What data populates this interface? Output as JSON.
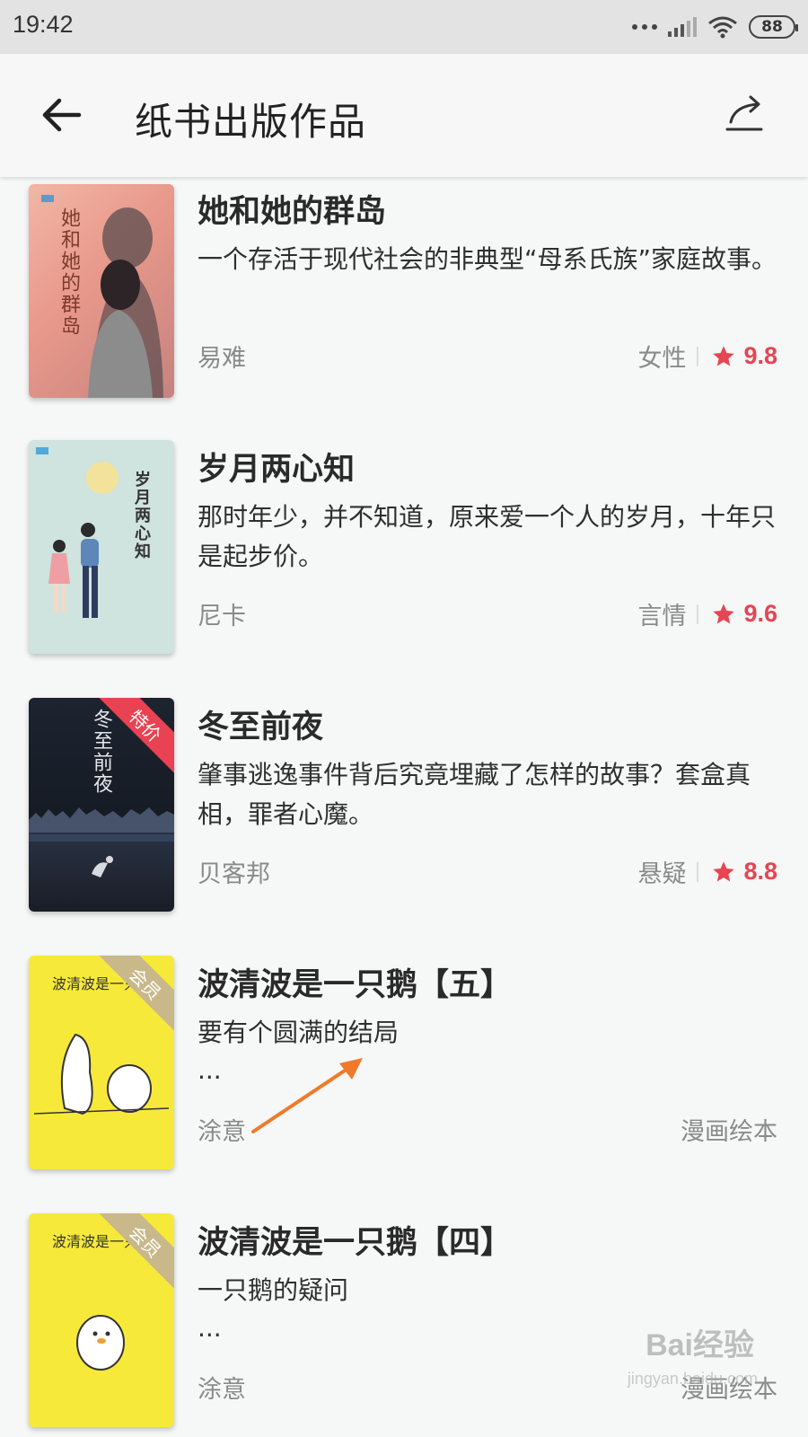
{
  "status_bar": {
    "time": "19:42",
    "battery": "88"
  },
  "header": {
    "title": "纸书出版作品",
    "back_icon": "arrow-left-icon",
    "share_icon": "share-icon"
  },
  "books": [
    {
      "title": "她和她的群岛",
      "desc": "一个存活于现代社会的非典型“母系氏族”家庭故事。",
      "author": "易难",
      "category": "女性",
      "rating": "9.8",
      "cover_text": "她和她的群岛",
      "badge": ""
    },
    {
      "title": "岁月两心知",
      "desc": "那时年少，并不知道，原来爱一个人的岁月，十年只是起步价。",
      "author": "尼卡",
      "category": "言情",
      "rating": "9.6",
      "cover_text": "岁月两心知",
      "badge": ""
    },
    {
      "title": "冬至前夜",
      "desc": "肇事逃逸事件背后究竟埋藏了怎样的故事？套盒真相，罪者心魔。",
      "author": "贝客邦",
      "category": "悬疑",
      "rating": "8.8",
      "cover_text": "冬至前夜",
      "badge": "特价"
    },
    {
      "title": "波清波是一只鹅【五】",
      "desc": "要有个圆满的结局",
      "ellipsis": "...",
      "author": "涂意",
      "category": "漫画绘本",
      "cover_text": "波清波是一只",
      "badge": "会员"
    },
    {
      "title": "波清波是一只鹅【四】",
      "desc": "一只鹅的疑问",
      "ellipsis": "...",
      "author": "涂意",
      "category": "漫画绘本",
      "cover_text": "波清波是一只",
      "badge": "会员"
    }
  ],
  "watermark": {
    "text": "Bai经验",
    "sub": "jingyan.baidu.com"
  },
  "colors": {
    "rating_red": "#e64552",
    "status_bar": "#e3e3e3",
    "annotation_orange": "#f07a2a"
  }
}
